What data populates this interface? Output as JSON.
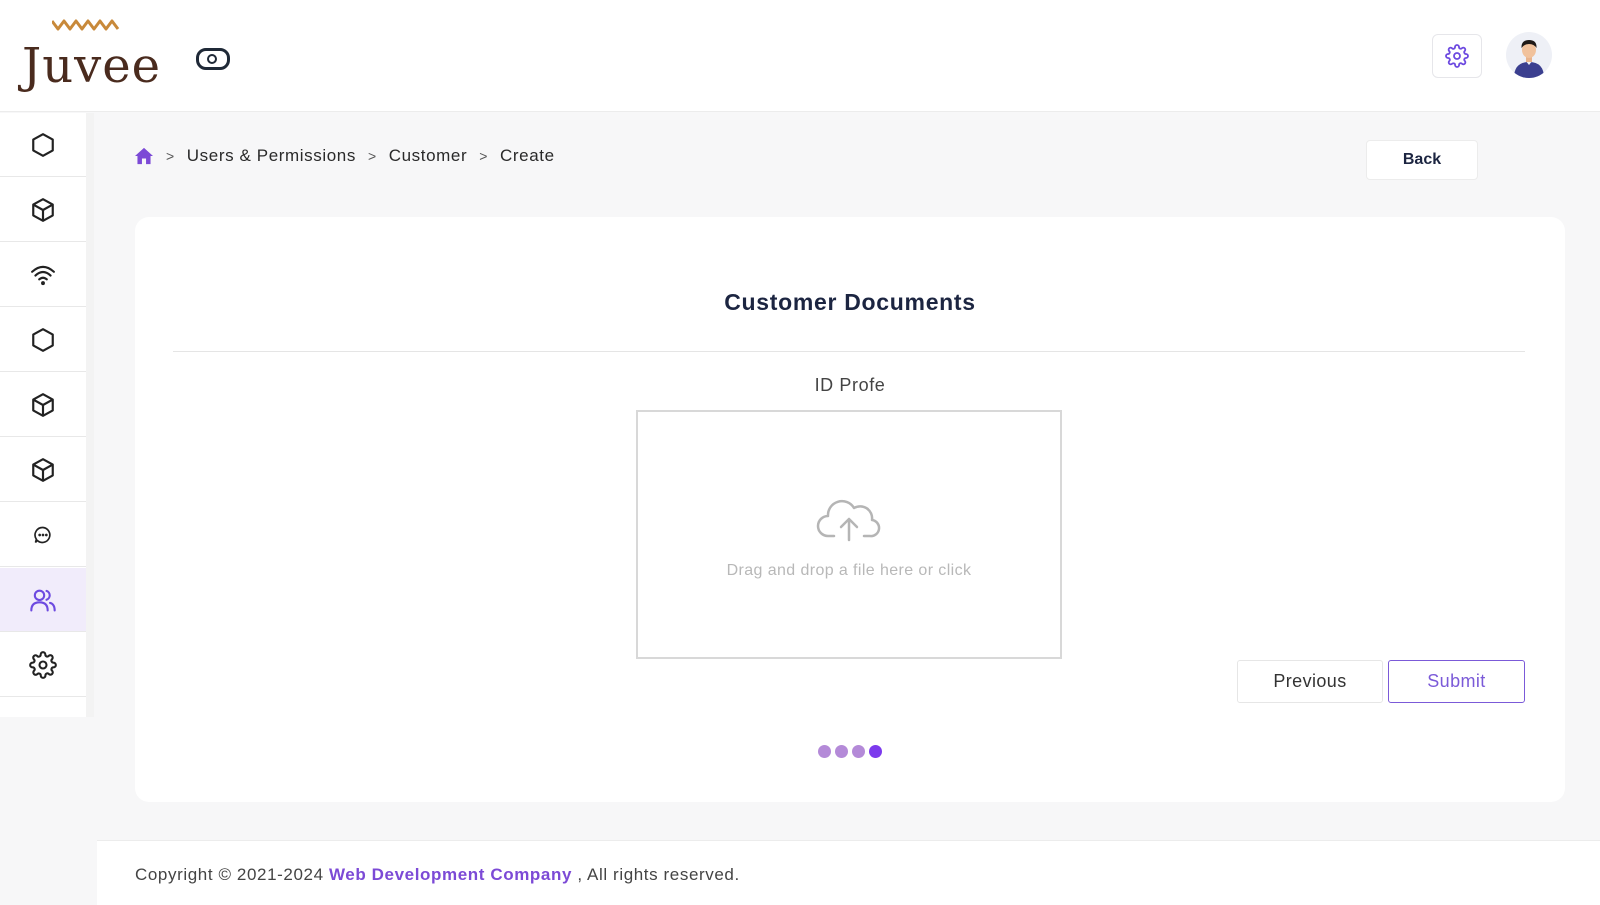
{
  "app": {
    "brand": "Juvee",
    "accent_color": "#7c4ad6",
    "logo_color": "#4a2b1e"
  },
  "header": {
    "toggle_icon": "toggle-icon",
    "settings_icon": "gear-icon",
    "avatar_icon": "user-avatar"
  },
  "sidebar": {
    "items": [
      {
        "icon": "hexagon-icon",
        "active": false
      },
      {
        "icon": "cube-icon",
        "active": false
      },
      {
        "icon": "wifi-icon",
        "active": false
      },
      {
        "icon": "hexagon-icon",
        "active": false
      },
      {
        "icon": "cube-icon",
        "active": false
      },
      {
        "icon": "cube-icon",
        "active": false
      },
      {
        "icon": "chat-icon",
        "active": false
      },
      {
        "icon": "users-icon",
        "active": true
      },
      {
        "icon": "gear-icon",
        "active": false
      }
    ]
  },
  "breadcrumb": {
    "home_icon": "home-icon",
    "separator": ">",
    "items": [
      "Users & Permissions",
      "Customer",
      "Create"
    ]
  },
  "actions": {
    "back_label": "Back"
  },
  "form": {
    "title": "Customer Documents",
    "field_label": "ID Profe",
    "dropzone_text": "Drag and drop a file here or click",
    "dropzone_icon": "cloud-upload-icon",
    "previous_label": "Previous",
    "submit_label": "Submit",
    "steps": {
      "total": 4,
      "current": 4
    }
  },
  "footer": {
    "prefix": "Copyright © 2021-2024",
    "company": "Web Development Company",
    "suffix": ", All rights reserved."
  }
}
